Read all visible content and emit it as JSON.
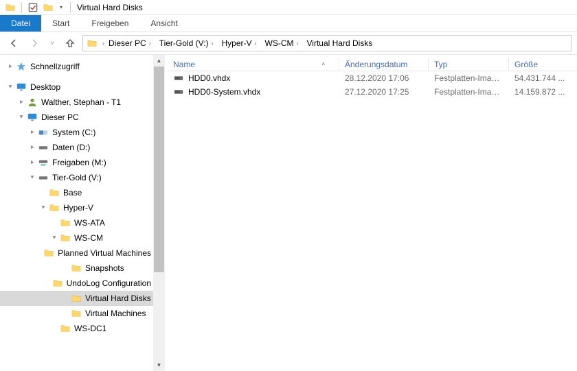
{
  "window": {
    "title": "Virtual Hard Disks"
  },
  "ribbon": {
    "file": "Datei",
    "tabs": [
      "Start",
      "Freigeben",
      "Ansicht"
    ]
  },
  "breadcrumb": [
    "Dieser PC",
    "Tier-Gold (V:)",
    "Hyper-V",
    "WS-CM",
    "Virtual Hard Disks"
  ],
  "navpane": {
    "quickaccess": "Schnellzugriff",
    "desktop": "Desktop",
    "user": "Walther, Stephan - T1",
    "thispc": "Dieser PC",
    "drives": {
      "system": "System (C:)",
      "daten": "Daten (D:)",
      "freigaben": "Freigaben (M:)",
      "tiergold": "Tier-Gold (V:)"
    },
    "folders": {
      "base": "Base",
      "hyperv": "Hyper-V",
      "wsata": "WS-ATA",
      "wscm": "WS-CM",
      "planned": "Planned Virtual Machines",
      "snapshots": "Snapshots",
      "undolog": "UndoLog Configuration",
      "vhd": "Virtual Hard Disks",
      "virtualmachines": "Virtual Machines",
      "wsdc1": "WS-DC1"
    }
  },
  "columns": {
    "name": "Name",
    "date": "Änderungsdatum",
    "type": "Typ",
    "size": "Größe"
  },
  "files": [
    {
      "name": "HDD0.vhdx",
      "date": "28.12.2020 17:06",
      "type": "Festplatten-Image...",
      "size": "54.431.744 ..."
    },
    {
      "name": "HDD0-System.vhdx",
      "date": "27.12.2020 17:25",
      "type": "Festplatten-Image...",
      "size": "14.159.872 ..."
    }
  ]
}
